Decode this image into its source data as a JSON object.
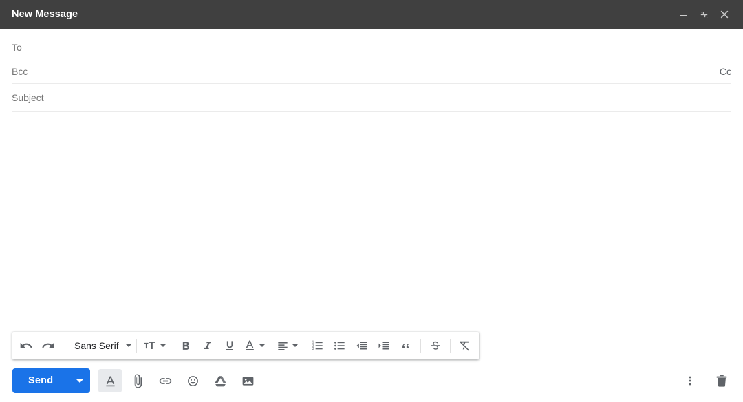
{
  "window": {
    "title": "New Message",
    "accent_color": "#1a73e8",
    "titlebar_color": "#404040",
    "controls": [
      {
        "name": "minimize",
        "label": "Minimize",
        "icon": "minimize-icon"
      },
      {
        "name": "pop-out",
        "label": "Exit full screen",
        "icon": "exit-fullscreen-icon"
      },
      {
        "name": "close",
        "label": "Save & close",
        "icon": "close-icon"
      }
    ]
  },
  "fields": {
    "to": {
      "label": "To",
      "value": "",
      "placeholder": "To"
    },
    "bcc": {
      "label": "Bcc",
      "value": "",
      "placeholder": "Bcc",
      "focused": true
    },
    "cc_link": "Cc",
    "subject": {
      "label": "Subject",
      "value": "",
      "placeholder": "Subject"
    },
    "body": {
      "value": "",
      "placeholder": ""
    }
  },
  "format_toolbar": {
    "undo": {
      "label": "Undo",
      "icon": "undo-icon"
    },
    "redo": {
      "label": "Redo",
      "icon": "redo-icon"
    },
    "font_family": {
      "label": "Font",
      "value": "Sans Serif",
      "icon": "chevron-down-icon"
    },
    "font_size": {
      "label": "Size",
      "icon": "font-size-icon"
    },
    "bold": {
      "label": "B",
      "icon": "bold-icon"
    },
    "italic": {
      "label": "I",
      "icon": "italic-icon"
    },
    "underline": {
      "label": "U",
      "icon": "underline-icon"
    },
    "text_color": {
      "label": "Text color",
      "icon": "text-color-icon"
    },
    "align": {
      "label": "Align",
      "icon": "align-icon"
    },
    "numbered_list": {
      "label": "Numbered list",
      "icon": "numbered-list-icon"
    },
    "bulleted_list": {
      "label": "Bulleted list",
      "icon": "bulleted-list-icon"
    },
    "indent_less": {
      "label": "Indent less",
      "icon": "indent-decrease-icon"
    },
    "indent_more": {
      "label": "Indent more",
      "icon": "indent-increase-icon"
    },
    "quote": {
      "label": "Quote",
      "icon": "quote-icon"
    },
    "strikethrough": {
      "label": "Strikethrough",
      "icon": "strikethrough-icon"
    },
    "remove_formatting": {
      "label": "Remove formatting",
      "icon": "remove-formatting-icon"
    }
  },
  "action_bar": {
    "send": {
      "label": "Send",
      "has_dropdown": true,
      "dropdown_icon": "chevron-down-icon"
    },
    "tools": [
      {
        "name": "formatting-options",
        "label": "Formatting options",
        "icon": "format-text-icon",
        "active": true
      },
      {
        "name": "attach-file",
        "label": "Attach files",
        "icon": "paperclip-icon",
        "active": false
      },
      {
        "name": "insert-link",
        "label": "Insert link",
        "icon": "link-icon",
        "active": false
      },
      {
        "name": "insert-emoji",
        "label": "Insert emoji",
        "icon": "emoji-icon",
        "active": false
      },
      {
        "name": "insert-drive",
        "label": "Insert files using Drive",
        "icon": "google-drive-icon",
        "active": false
      },
      {
        "name": "insert-photo",
        "label": "Insert photo",
        "icon": "photo-icon",
        "active": false
      }
    ],
    "more_options": {
      "label": "More options",
      "icon": "more-vertical-icon"
    },
    "discard": {
      "label": "Discard draft",
      "icon": "trash-icon"
    }
  }
}
